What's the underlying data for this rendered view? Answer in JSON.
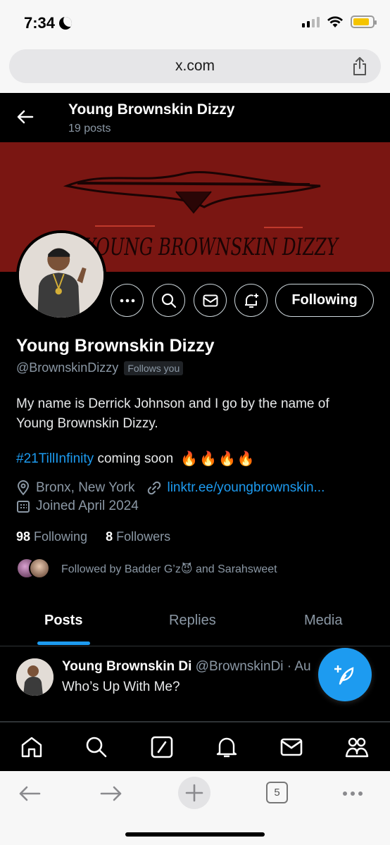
{
  "status_bar": {
    "time": "7:34",
    "battery_level": 0.85
  },
  "browser": {
    "url": "x.com",
    "tab_count": "5"
  },
  "header": {
    "name": "Young Brownskin Dizzy",
    "posts_count": "19 posts"
  },
  "banner": {
    "text": "YOUNG BROWNSKIN DIZZY",
    "background_color": "#7a1612"
  },
  "profile": {
    "name": "Young Brownskin Dizzy",
    "handle": "@BrownskinDizzy",
    "follows_you": "Follows you",
    "follow_button": "Following",
    "bio_line": "My name is Derrick Johnson and I go by the name of Young Brownskin Dizzy.",
    "hashtag": "#21TillInfinity",
    "bio_after_hashtag": " coming soon",
    "fire_emojis": [
      "🔥",
      "🔥",
      "🔥",
      "🔥"
    ],
    "location": "Bronx, New York",
    "link": "linktr.ee/youngbrownskin...",
    "joined": "Joined April 2024",
    "following_count": "98",
    "following_label": "Following",
    "followers_count": "8",
    "followers_label": "Followers",
    "followed_by": "Followed by Badder G’z😈 and Sarahsweet"
  },
  "tabs": [
    {
      "label": "Posts",
      "active": true
    },
    {
      "label": "Replies",
      "active": false
    },
    {
      "label": "Media",
      "active": false
    }
  ],
  "post": {
    "author": "Young Brownskin Di",
    "meta": " @BrownskinDi · Au",
    "text": "Who’s Up With Me?"
  },
  "bottom_nav": [
    "home-icon",
    "search-icon",
    "grok-icon",
    "notifications-icon",
    "messages-icon",
    "communities-icon"
  ],
  "colors": {
    "accent": "#1d9bf0",
    "background": "#000000",
    "muted": "#8b98a5"
  }
}
